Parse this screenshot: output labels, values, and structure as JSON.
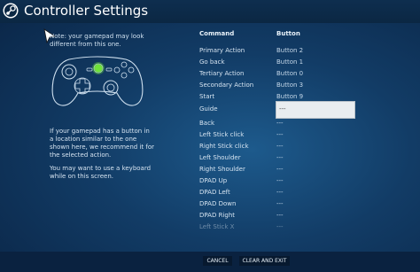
{
  "header": {
    "title": "Controller Settings"
  },
  "left": {
    "note": "Note: your gamepad may look different from this one.",
    "info": "If your gamepad has a button in a location similar to the one shown here, we recommend it for the selected action.",
    "keyboard_note": "You may want to use a keyboard while on this screen."
  },
  "table": {
    "header_command": "Command",
    "header_button": "Button",
    "rows": [
      {
        "command": "Primary Action",
        "button": "Button 2"
      },
      {
        "command": "Go back",
        "button": "Button 1"
      },
      {
        "command": "Tertiary Action",
        "button": "Button 0"
      },
      {
        "command": "Secondary Action",
        "button": "Button 3"
      },
      {
        "command": "Start",
        "button": "Button 9"
      },
      {
        "command": "Guide",
        "button": "---"
      },
      {
        "command": "Back",
        "button": "---"
      },
      {
        "command": "Left Stick click",
        "button": "---"
      },
      {
        "command": "Right Stick click",
        "button": "---"
      },
      {
        "command": "Left Shoulder",
        "button": "---"
      },
      {
        "command": "Right Shoulder",
        "button": "---"
      },
      {
        "command": "DPAD Up",
        "button": "---"
      },
      {
        "command": "DPAD Left",
        "button": "---"
      },
      {
        "command": "DPAD Down",
        "button": "---"
      },
      {
        "command": "DPAD Right",
        "button": "---"
      },
      {
        "command": "Left Stick X",
        "button": "---"
      }
    ]
  },
  "footer": {
    "cancel": "CANCEL",
    "clear_exit": "CLEAR AND EXIT"
  },
  "colors": {
    "background": "#123c66",
    "highlight_button": "#6fe23a",
    "field": "#e9edf0"
  }
}
